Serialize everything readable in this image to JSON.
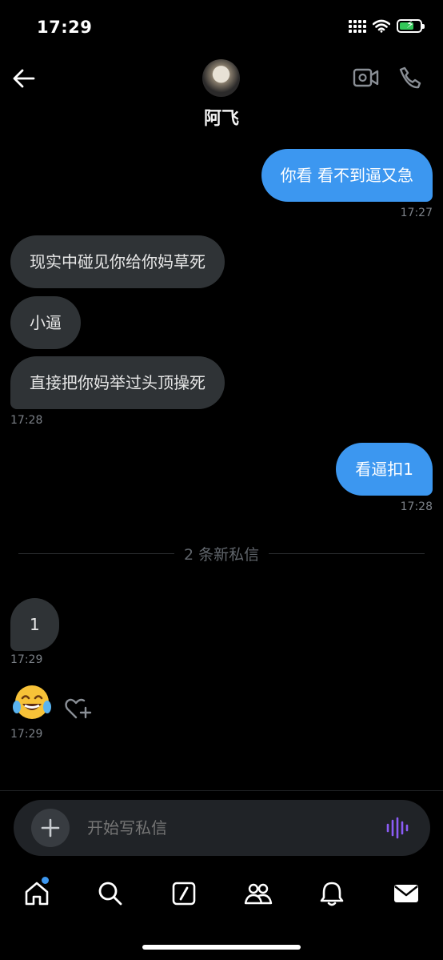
{
  "status_bar": {
    "time": "17:29"
  },
  "header": {
    "contact_name": "阿飞"
  },
  "messages": [
    {
      "id": "m1",
      "side": "out",
      "text": "你看 看不到逼又急",
      "time": "17:27"
    },
    {
      "id": "m2",
      "side": "in",
      "text": "现实中碰见你给你妈草死"
    },
    {
      "id": "m3",
      "side": "in",
      "text": "小逼"
    },
    {
      "id": "m4",
      "side": "in",
      "text": "直接把你妈举过头顶操死",
      "time": "17:28"
    },
    {
      "id": "m5",
      "side": "out",
      "text": "看逼扣1",
      "time": "17:28"
    },
    {
      "id": "m6",
      "side": "in",
      "text": "1",
      "time": "17:29"
    },
    {
      "id": "m7",
      "side": "in",
      "emoji": "😂",
      "time": "17:29"
    }
  ],
  "divider": {
    "label": "2 条新私信"
  },
  "composer": {
    "placeholder": "开始写私信",
    "value": ""
  },
  "icons": {
    "back": "back-arrow-icon",
    "video": "video-call-icon",
    "call": "phone-call-icon",
    "add": "plus-icon",
    "voice": "voice-wave-icon",
    "react": "heart-plus-icon"
  },
  "nav": [
    {
      "id": "home",
      "icon": "home-icon",
      "badge": true
    },
    {
      "id": "search",
      "icon": "search-icon"
    },
    {
      "id": "compose",
      "icon": "compose-icon"
    },
    {
      "id": "communities",
      "icon": "communities-icon"
    },
    {
      "id": "notifications",
      "icon": "bell-icon"
    },
    {
      "id": "messages",
      "icon": "mail-icon",
      "active": true
    }
  ],
  "colors": {
    "accent": "#3c97f0",
    "incoming_bubble": "#2f3336",
    "voice": "#8b5cf6"
  }
}
